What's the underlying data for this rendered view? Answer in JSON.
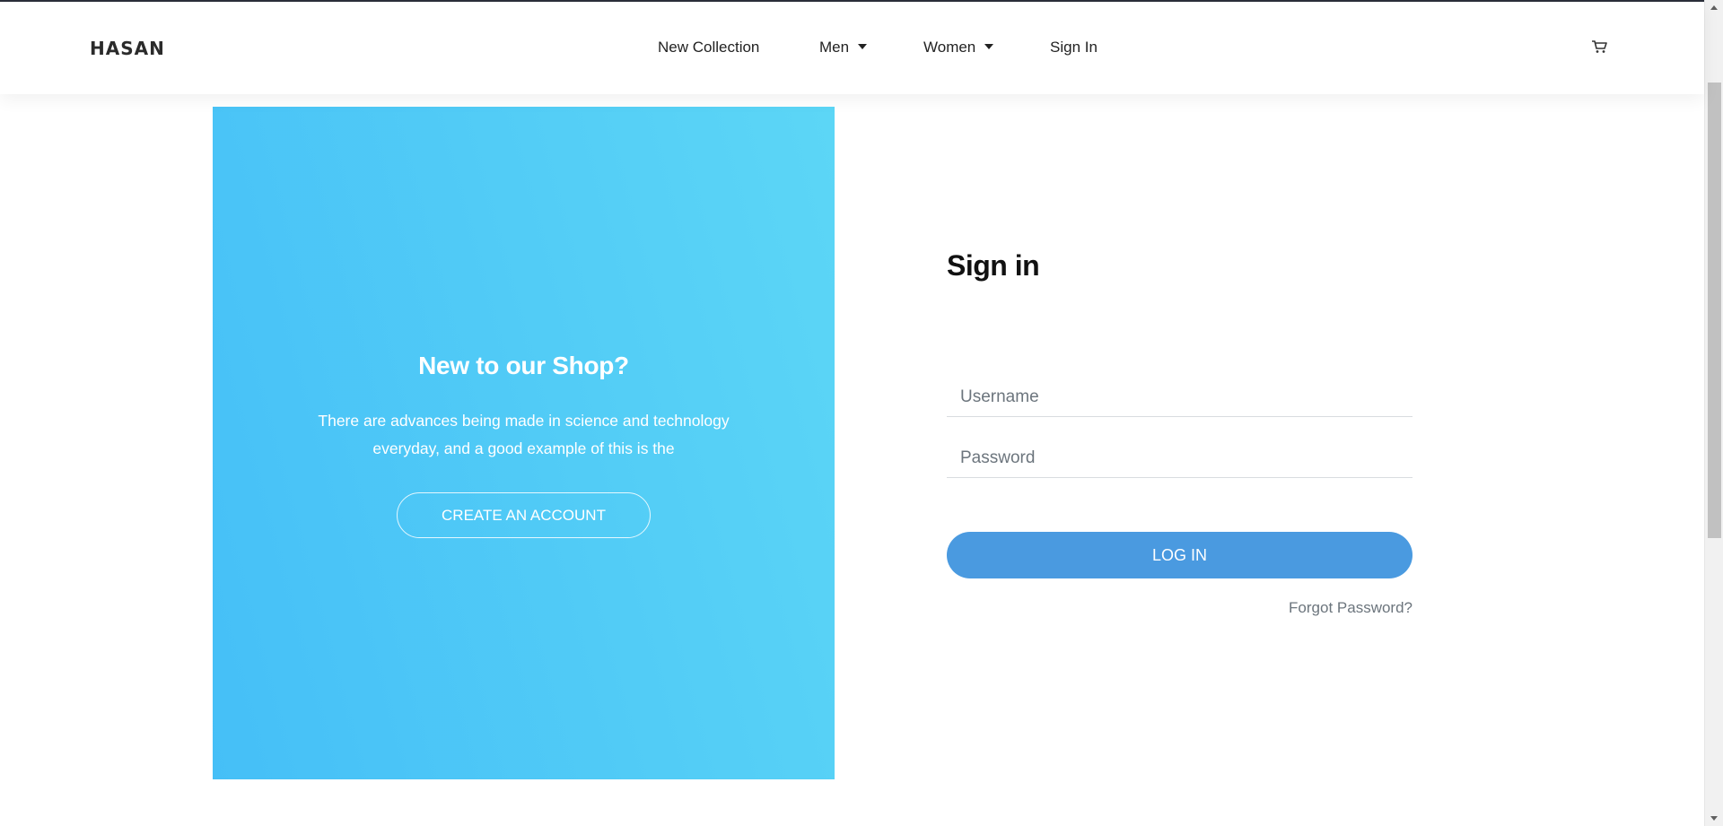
{
  "brand": {
    "logo_text": "HASAN"
  },
  "nav": {
    "items": [
      {
        "label": "New Collection",
        "has_dropdown": false
      },
      {
        "label": "Men",
        "has_dropdown": true
      },
      {
        "label": "Women",
        "has_dropdown": true
      },
      {
        "label": "Sign In",
        "has_dropdown": false
      }
    ],
    "cart_icon": "shopping-cart-icon"
  },
  "promo": {
    "title": "New to our Shop?",
    "text_line1": "There are advances being made in science and technology",
    "text_line2": "everyday, and a good example of this is the",
    "button_label": "CREATE AN ACCOUNT",
    "gradient_start": "#45bff7",
    "gradient_end": "#5cd6f6"
  },
  "signin": {
    "title": "Sign in",
    "username_placeholder": "Username",
    "username_value": "",
    "password_placeholder": "Password",
    "password_value": "",
    "login_label": "LOG IN",
    "forgot_label": "Forgot Password?",
    "accent_color": "#4a9ae0"
  }
}
